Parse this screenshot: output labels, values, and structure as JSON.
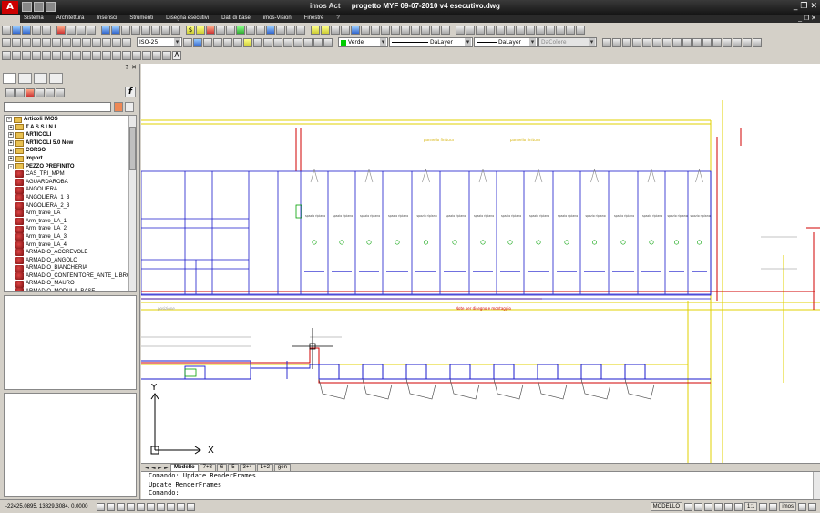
{
  "window": {
    "app_name": "imos Act",
    "document_title": "progetto MYF 09-07-2010 v4 esecutivo.dwg",
    "logo_letter": "A",
    "minimize": "_",
    "restore": "❐",
    "close": "✕"
  },
  "menu": {
    "items": [
      "Sistema",
      "Architettura",
      "Inserisci",
      "Strumenti",
      "Disegna esecutivi",
      "Dati di base",
      "imos-Vision",
      "Finestre",
      "?"
    ],
    "mdi_buttons": "_ ❐ ✕"
  },
  "toolbar": {
    "style_combo": "ISO-25",
    "color_combo": "Verde",
    "linetype_combo": "DaLayer",
    "lineweight_combo": "DaLayer",
    "plotstyle_combo": "DaColore",
    "text_tool": "A",
    "zoom_hint": "$"
  },
  "left_panel": {
    "help_btn": "?",
    "close_btn": "✕",
    "fx_label": "f",
    "search_value": "",
    "tree": [
      {
        "label": "Articoli IMOS",
        "kind": "root",
        "exp": "-"
      },
      {
        "label": "T A S S I N I",
        "kind": "folder",
        "exp": "+"
      },
      {
        "label": "ARTICOLI",
        "kind": "folder",
        "exp": "+"
      },
      {
        "label": "ARTICOLI 5.0 New",
        "kind": "folder",
        "exp": "+"
      },
      {
        "label": "CORSO",
        "kind": "folder",
        "exp": "+"
      },
      {
        "label": "Import",
        "kind": "folder",
        "exp": "+"
      },
      {
        "label": "PEZZO PREFINITO",
        "kind": "folder",
        "exp": "-"
      },
      {
        "label": "CAS_TRI_MPM",
        "kind": "item"
      },
      {
        "label": "AGUARDAROBA",
        "kind": "item"
      },
      {
        "label": "ANGOLIERA",
        "kind": "item"
      },
      {
        "label": "ANGOLIERA_1_3",
        "kind": "item"
      },
      {
        "label": "ANGOLIERA_2_3",
        "kind": "item"
      },
      {
        "label": "Arm_trave_LA",
        "kind": "item"
      },
      {
        "label": "Arm_trave_LA_1",
        "kind": "item"
      },
      {
        "label": "Arm_trave_LA_2",
        "kind": "item"
      },
      {
        "label": "Arm_trave_LA_3",
        "kind": "item"
      },
      {
        "label": "Arm_trave_LA_4",
        "kind": "item"
      },
      {
        "label": "ARMADIO_ACCREVOLE",
        "kind": "item"
      },
      {
        "label": "ARMADIO_ANGOLO",
        "kind": "item"
      },
      {
        "label": "ARMADIO_BIANCHERIA",
        "kind": "item"
      },
      {
        "label": "ARMADIO_CONTENITORE_ANTE_LIBRO",
        "kind": "item"
      },
      {
        "label": "ARMADIO_MAURO",
        "kind": "item"
      },
      {
        "label": "ARMADIO_MODULA_BASE",
        "kind": "item"
      }
    ]
  },
  "layout_tabs": {
    "nav": [
      "◄",
      "◄",
      "►",
      "►"
    ],
    "tabs": [
      {
        "label": "Modello",
        "active": true
      },
      {
        "label": "7+8",
        "active": false
      },
      {
        "label": "6",
        "active": false
      },
      {
        "label": "5",
        "active": false
      },
      {
        "label": "3+4",
        "active": false
      },
      {
        "label": "1+2",
        "active": false
      },
      {
        "label": "gen",
        "active": false
      }
    ]
  },
  "command_line": {
    "line1": "Comando: Update RenderFrames",
    "line2": "Update RenderFrames",
    "prompt": "Comando:"
  },
  "statusbar": {
    "coordinates": "-22425.0895, 13829.3084, 0.0000",
    "model_label": "MODELLO",
    "scale": "1:1",
    "workspace": "imos"
  },
  "drawing": {
    "axis_x": "X",
    "axis_y": "Y",
    "annotations": {
      "module_label": "spazio ripiano",
      "header_note": "pannello finitura",
      "note_red": "Note per disegno e montaggio",
      "pos_label": "posizione"
    }
  },
  "colors": {
    "title_bg": "#1c1c1c",
    "drawing_blue": "#1a1acc",
    "drawing_red": "#d00000",
    "drawing_yellow": "#e0d000",
    "drawing_green": "#00a000"
  }
}
